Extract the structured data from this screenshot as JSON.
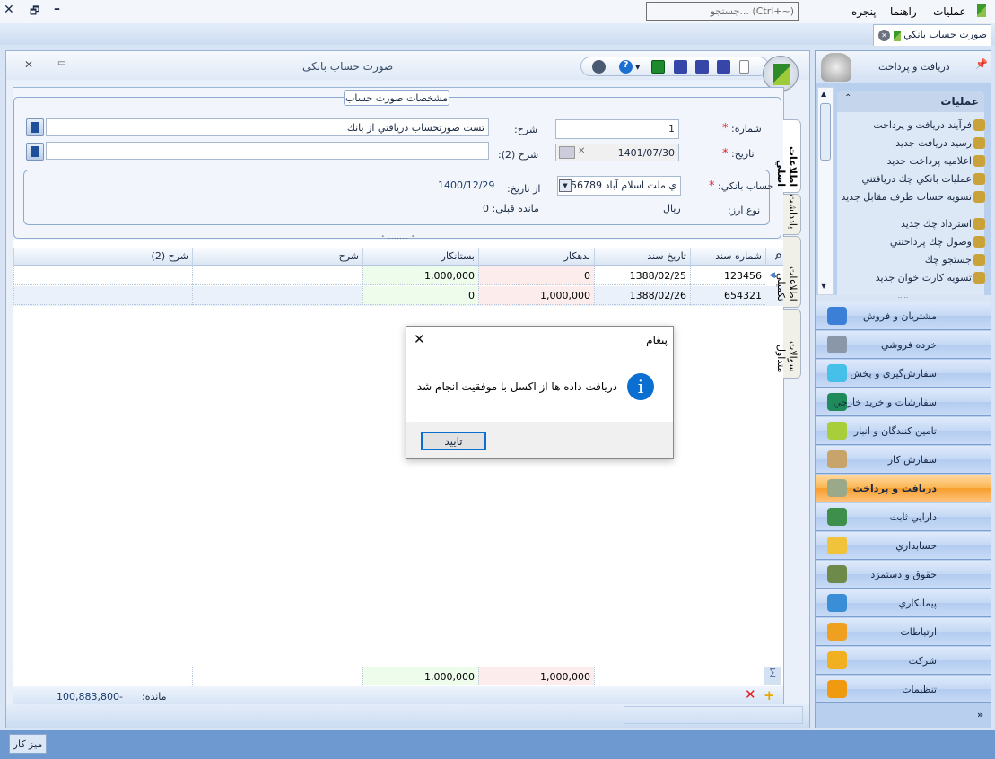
{
  "menubar": {
    "items": [
      "عمليات",
      "راهنما",
      "پنجره"
    ],
    "search_placeholder": "جستجو... (Ctrl+~)"
  },
  "window_controls": {
    "close": "✕",
    "restore": "🗗",
    "minimize": "–"
  },
  "doc_tab": {
    "label": "صورت حساب بانكي"
  },
  "form": {
    "title": "صورت حساب بانکی",
    "title_controls": {
      "close": "✕",
      "restore": "▭",
      "minimize": "–"
    },
    "toolbar_icons": [
      "new-icon",
      "save-icon",
      "save-as-icon",
      "save-close-icon",
      "excel-icon",
      "help-icon",
      "dropdown-icon",
      "settings-icon"
    ],
    "groupbox_title": "مشخصات صورت حساب",
    "number_label": "شماره:",
    "number_value": "1",
    "desc_label": "شرح:",
    "desc_value": "تست صورتحساب دريافتي از بانك",
    "date_label": "تاريخ:",
    "date_value": "1401/07/30",
    "desc2_label": "شرح (2):",
    "desc2_value": "",
    "bank_label": "حساب بانكي:",
    "bank_value": "ي ملت اسلام آباد 56789",
    "from_date_label": "از تاريخ:",
    "from_date_value": "1400/12/29",
    "currency_label": "نوع ارز:",
    "currency_value": "ريال",
    "prev_balance": "مانده قبلی: 0",
    "required_mark": "*"
  },
  "side_tabs": [
    "اطلاعات اصلي",
    "يادداشت",
    "اطلاعات تكميلي",
    "سوالات متداول"
  ],
  "grid": {
    "columns": [
      "شماره سند",
      "تاريخ سند",
      "بدهكار",
      "بستانكار",
      "شرح",
      "شرح (2)"
    ],
    "rows": [
      {
        "doc_no": "123456",
        "date": "1388/02/25",
        "debit": "0",
        "credit": "1,000,000",
        "desc": "",
        "desc2": ""
      },
      {
        "doc_no": "654321",
        "date": "1388/02/26",
        "debit": "1,000,000",
        "credit": "0",
        "desc": "",
        "desc2": ""
      }
    ],
    "totals": {
      "debit": "1,000,000",
      "credit": "1,000,000"
    },
    "sum_symbol": "Σ",
    "balance_label": "مانده:",
    "balance_value": "100,883,800-"
  },
  "sidebar": {
    "header": "دريافت و پرداخت",
    "ops_title": "عمليات",
    "ops": [
      "فرآيند دريافت و پرداخت",
      "رسيد دريافت جديد",
      "اعلاميه پرداخت جديد",
      "عمليات بانكي چك دريافتني",
      "تسويه حساب طرف مقابل جديد",
      "استرداد چك جديد",
      "وصول چك پرداختني",
      "جستجو چك",
      "تسويه كارت خوان جديد"
    ],
    "nav": [
      "مشتريان و فروش",
      "خرده فروشي",
      "سفارش‌گيري و پخش",
      "سفارشات و خريد خارجي",
      "تامين كنندگان و انبار",
      "سفارش كار",
      "دريافت و پرداخت",
      "دارايي ثابت",
      "حسابداري",
      "حقوق و دستمزد",
      "پيمانكاري",
      "ارتباطات",
      "شركت",
      "تنظيمات"
    ],
    "active_nav": "دريافت و پرداخت",
    "nav_colors": [
      "#3b7fd6",
      "#8a97a8",
      "#46c0e8",
      "#1f8a5a",
      "#a8cf3a",
      "#c9a46a",
      "#9aa98a",
      "#3d8f4b",
      "#f0c33a",
      "#6e8a4a",
      "#3a8ed8",
      "#f0a020",
      "#f0b020",
      "#f09a10"
    ]
  },
  "taskbar": {
    "desktop_label": "ميز كار"
  },
  "dialog": {
    "title": "پيغام",
    "message": "دريافت داده ها از اكسل با موفقيت انجام شد",
    "ok_label": "تاييد",
    "close": "✕",
    "info_icon": "i"
  }
}
